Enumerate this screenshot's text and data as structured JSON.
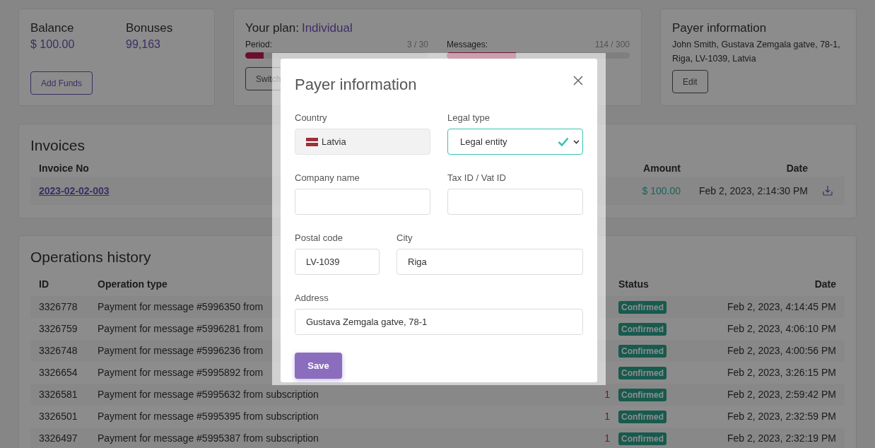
{
  "balance_card": {
    "balance_label": "Balance",
    "balance": "$ 100.00",
    "bonuses_label": "Bonuses",
    "bonuses": "99,163",
    "button": "Add Funds"
  },
  "plan_card": {
    "title": "Your plan:",
    "plan": "Individual",
    "meters": [
      {
        "label": "Period:",
        "reading": "3 / 30",
        "level": 0.1
      },
      {
        "label": "Messages:",
        "reading": "114 / 300",
        "level": 0.38
      }
    ],
    "button": "Switch"
  },
  "payer_card": {
    "title": "Payer information",
    "text": "John Smith, Gustava Zemgala gatve, 78-1, Riga, LV-1039, Latvia",
    "button": "Edit"
  },
  "invoices": {
    "title": "Invoices",
    "columns": [
      "Invoice No",
      "Amount",
      "Date"
    ],
    "rows": [
      {
        "invoice_no": "2023-02-02-003",
        "amount": "$ 100.00",
        "date": "Feb 2, 2023, 2:14:30 PM"
      }
    ]
  },
  "operations": {
    "title": "Operations history",
    "columns": [
      "ID",
      "Operation type",
      "Status",
      "Date"
    ],
    "rows": [
      {
        "id": "3326778",
        "type": "Payment for message #5996350 from",
        "status": "Confirmed",
        "date": "Feb 2, 2023, 4:14:45 PM"
      },
      {
        "id": "3326759",
        "type": "Payment for message #5996281 from",
        "status": "Confirmed",
        "date": "Feb 2, 2023, 4:06:10 PM"
      },
      {
        "id": "3326748",
        "type": "Payment for message #5996236 from",
        "status": "Confirmed",
        "date": "Feb 2, 2023, 4:00:56 PM"
      },
      {
        "id": "3326654",
        "type": "Payment for message #5995892 from",
        "status": "Confirmed",
        "date": "Feb 2, 2023, 3:26:15 PM"
      },
      {
        "id": "3326581",
        "type": "Payment for message #5995632 from subscription",
        "amount": "1",
        "status": "Confirmed",
        "date": "Feb 2, 2023, 2:59:42 PM"
      },
      {
        "id": "3326501",
        "type": "Payment for message #5995395 from subscription",
        "amount": "1",
        "status": "Confirmed",
        "date": "Feb 2, 2023, 2:32:59 PM"
      },
      {
        "id": "3326497",
        "type": "Payment for message #5995387 from subscription",
        "amount": "1",
        "status": "Confirmed",
        "date": "Feb 2, 2023, 2:32:19 PM"
      }
    ]
  },
  "modal": {
    "title": "Payer information",
    "rows": [
      [
        {
          "kind": "country",
          "label": "Country",
          "value": "Latvia"
        },
        {
          "kind": "select",
          "label": "Legal type",
          "value": "Legal entity",
          "valid": true
        }
      ],
      [
        {
          "kind": "text",
          "label": "Company name"
        },
        {
          "kind": "text",
          "label": "Tax ID / Vat ID"
        }
      ],
      [
        {
          "kind": "short",
          "label": "Postal code",
          "value": "LV-1039"
        },
        {
          "kind": "text",
          "label": "City",
          "value": "Riga"
        }
      ],
      [
        {
          "kind": "text",
          "label": "Address",
          "value": "Gustava Zemgala gatve, 78-1"
        }
      ]
    ],
    "button": "Save"
  }
}
